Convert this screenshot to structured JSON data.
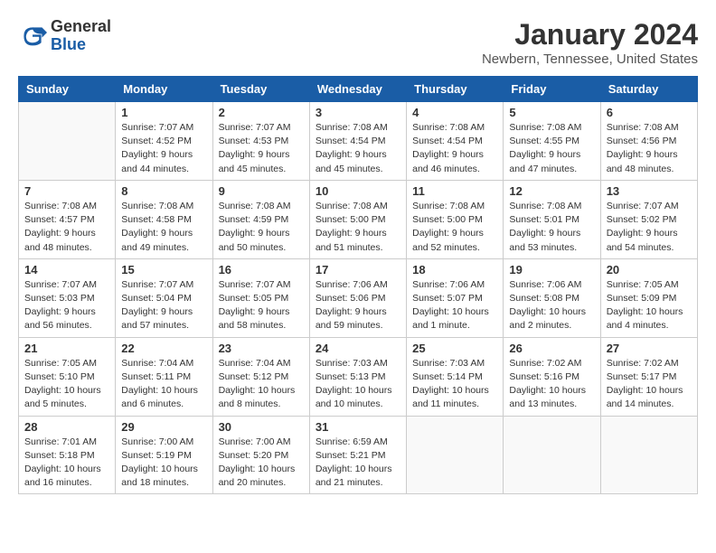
{
  "header": {
    "logo_general": "General",
    "logo_blue": "Blue",
    "month_title": "January 2024",
    "location": "Newbern, Tennessee, United States"
  },
  "weekdays": [
    "Sunday",
    "Monday",
    "Tuesday",
    "Wednesday",
    "Thursday",
    "Friday",
    "Saturday"
  ],
  "weeks": [
    [
      {
        "day": "",
        "info": ""
      },
      {
        "day": "1",
        "info": "Sunrise: 7:07 AM\nSunset: 4:52 PM\nDaylight: 9 hours\nand 44 minutes."
      },
      {
        "day": "2",
        "info": "Sunrise: 7:07 AM\nSunset: 4:53 PM\nDaylight: 9 hours\nand 45 minutes."
      },
      {
        "day": "3",
        "info": "Sunrise: 7:08 AM\nSunset: 4:54 PM\nDaylight: 9 hours\nand 45 minutes."
      },
      {
        "day": "4",
        "info": "Sunrise: 7:08 AM\nSunset: 4:54 PM\nDaylight: 9 hours\nand 46 minutes."
      },
      {
        "day": "5",
        "info": "Sunrise: 7:08 AM\nSunset: 4:55 PM\nDaylight: 9 hours\nand 47 minutes."
      },
      {
        "day": "6",
        "info": "Sunrise: 7:08 AM\nSunset: 4:56 PM\nDaylight: 9 hours\nand 48 minutes."
      }
    ],
    [
      {
        "day": "7",
        "info": "Sunrise: 7:08 AM\nSunset: 4:57 PM\nDaylight: 9 hours\nand 48 minutes."
      },
      {
        "day": "8",
        "info": "Sunrise: 7:08 AM\nSunset: 4:58 PM\nDaylight: 9 hours\nand 49 minutes."
      },
      {
        "day": "9",
        "info": "Sunrise: 7:08 AM\nSunset: 4:59 PM\nDaylight: 9 hours\nand 50 minutes."
      },
      {
        "day": "10",
        "info": "Sunrise: 7:08 AM\nSunset: 5:00 PM\nDaylight: 9 hours\nand 51 minutes."
      },
      {
        "day": "11",
        "info": "Sunrise: 7:08 AM\nSunset: 5:00 PM\nDaylight: 9 hours\nand 52 minutes."
      },
      {
        "day": "12",
        "info": "Sunrise: 7:08 AM\nSunset: 5:01 PM\nDaylight: 9 hours\nand 53 minutes."
      },
      {
        "day": "13",
        "info": "Sunrise: 7:07 AM\nSunset: 5:02 PM\nDaylight: 9 hours\nand 54 minutes."
      }
    ],
    [
      {
        "day": "14",
        "info": "Sunrise: 7:07 AM\nSunset: 5:03 PM\nDaylight: 9 hours\nand 56 minutes."
      },
      {
        "day": "15",
        "info": "Sunrise: 7:07 AM\nSunset: 5:04 PM\nDaylight: 9 hours\nand 57 minutes."
      },
      {
        "day": "16",
        "info": "Sunrise: 7:07 AM\nSunset: 5:05 PM\nDaylight: 9 hours\nand 58 minutes."
      },
      {
        "day": "17",
        "info": "Sunrise: 7:06 AM\nSunset: 5:06 PM\nDaylight: 9 hours\nand 59 minutes."
      },
      {
        "day": "18",
        "info": "Sunrise: 7:06 AM\nSunset: 5:07 PM\nDaylight: 10 hours\nand 1 minute."
      },
      {
        "day": "19",
        "info": "Sunrise: 7:06 AM\nSunset: 5:08 PM\nDaylight: 10 hours\nand 2 minutes."
      },
      {
        "day": "20",
        "info": "Sunrise: 7:05 AM\nSunset: 5:09 PM\nDaylight: 10 hours\nand 4 minutes."
      }
    ],
    [
      {
        "day": "21",
        "info": "Sunrise: 7:05 AM\nSunset: 5:10 PM\nDaylight: 10 hours\nand 5 minutes."
      },
      {
        "day": "22",
        "info": "Sunrise: 7:04 AM\nSunset: 5:11 PM\nDaylight: 10 hours\nand 6 minutes."
      },
      {
        "day": "23",
        "info": "Sunrise: 7:04 AM\nSunset: 5:12 PM\nDaylight: 10 hours\nand 8 minutes."
      },
      {
        "day": "24",
        "info": "Sunrise: 7:03 AM\nSunset: 5:13 PM\nDaylight: 10 hours\nand 10 minutes."
      },
      {
        "day": "25",
        "info": "Sunrise: 7:03 AM\nSunset: 5:14 PM\nDaylight: 10 hours\nand 11 minutes."
      },
      {
        "day": "26",
        "info": "Sunrise: 7:02 AM\nSunset: 5:16 PM\nDaylight: 10 hours\nand 13 minutes."
      },
      {
        "day": "27",
        "info": "Sunrise: 7:02 AM\nSunset: 5:17 PM\nDaylight: 10 hours\nand 14 minutes."
      }
    ],
    [
      {
        "day": "28",
        "info": "Sunrise: 7:01 AM\nSunset: 5:18 PM\nDaylight: 10 hours\nand 16 minutes."
      },
      {
        "day": "29",
        "info": "Sunrise: 7:00 AM\nSunset: 5:19 PM\nDaylight: 10 hours\nand 18 minutes."
      },
      {
        "day": "30",
        "info": "Sunrise: 7:00 AM\nSunset: 5:20 PM\nDaylight: 10 hours\nand 20 minutes."
      },
      {
        "day": "31",
        "info": "Sunrise: 6:59 AM\nSunset: 5:21 PM\nDaylight: 10 hours\nand 21 minutes."
      },
      {
        "day": "",
        "info": ""
      },
      {
        "day": "",
        "info": ""
      },
      {
        "day": "",
        "info": ""
      }
    ]
  ]
}
